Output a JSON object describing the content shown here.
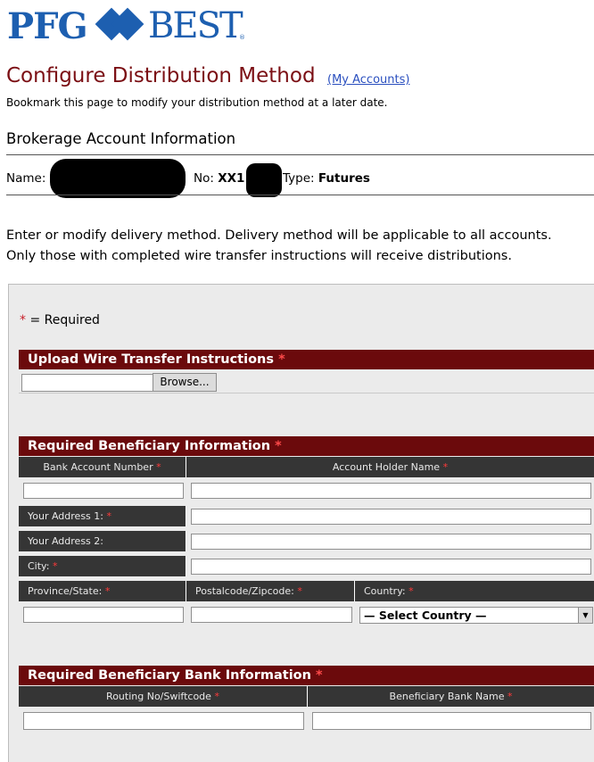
{
  "logo": {
    "part1": "PFG",
    "part2": "BEST",
    "reg": "®"
  },
  "header": {
    "title": "Configure Distribution Method",
    "my_accounts_link": "(My Accounts)",
    "subtext": "Bookmark this page to modify your distribution method at a later date."
  },
  "account": {
    "heading": "Brokerage Account Information",
    "name_label": "Name:",
    "no_label": "No:",
    "no_value": "XX1",
    "type_label": "Type:",
    "type_value": "Futures"
  },
  "intro": {
    "line1": "Enter or modify delivery method. Delivery method will be applicable to all accounts.",
    "line2": "Only those with completed wire transfer instructions will receive distributions."
  },
  "form": {
    "required_star": "*",
    "required_note": " = Required",
    "upload": {
      "title": "Upload Wire Transfer Instructions",
      "browse_label": "Browse..."
    },
    "beneficiary": {
      "title": "Required Beneficiary Information",
      "bank_account_number": "Bank Account Number",
      "account_holder_name": "Account Holder Name",
      "address1": "Your Address 1:",
      "address2": "Your Address 2:",
      "city": "City:",
      "province": "Province/State:",
      "postal": "Postalcode/Zipcode:",
      "country": "Country:",
      "country_selected": "— Select Country —"
    },
    "bank": {
      "title": "Required Beneficiary Bank Information",
      "routing": "Routing No/Swiftcode",
      "bank_name": "Beneficiary Bank Name"
    }
  }
}
